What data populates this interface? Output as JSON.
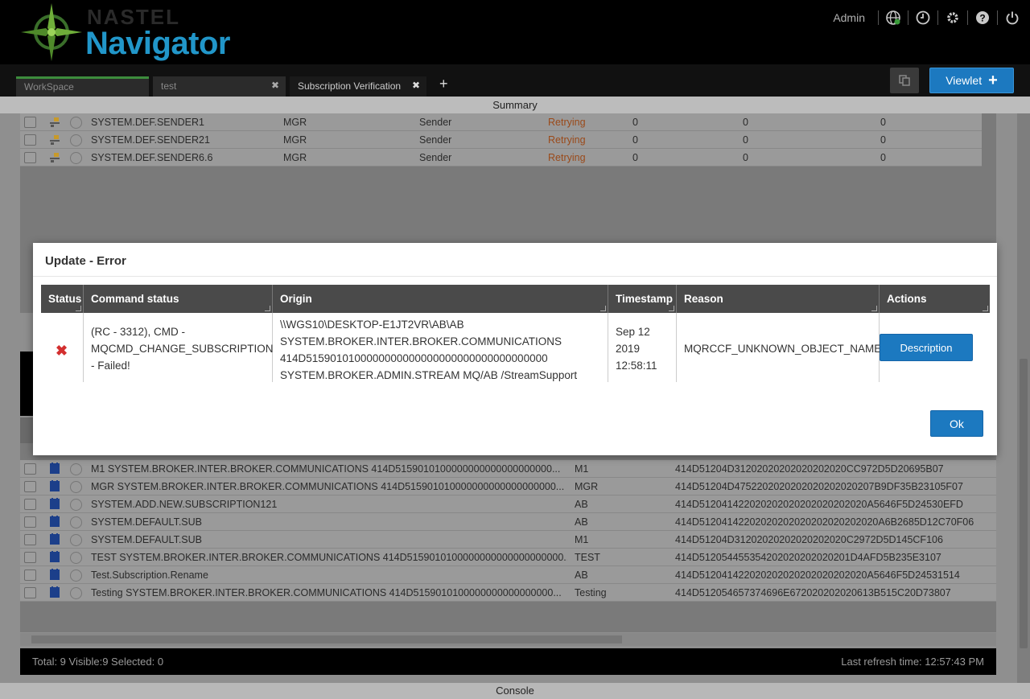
{
  "header": {
    "logo_top": "NASTEL",
    "logo_main": "Navigator",
    "user": "Admin"
  },
  "tabs": [
    {
      "label": "WorkSpace"
    },
    {
      "label": "test"
    },
    {
      "label": "Subscription Verification"
    }
  ],
  "toolbar": {
    "add_tab_label": "+",
    "viewlet_label": "Viewlet"
  },
  "summary_label": "Summary",
  "top_grid": {
    "rows": [
      {
        "name": "SYSTEM.DEF.SENDER1",
        "qmgr": "MGR",
        "type": "Sender",
        "status": "Retrying",
        "c1": "0",
        "c2": "0",
        "c3": "0"
      },
      {
        "name": "SYSTEM.DEF.SENDER21",
        "qmgr": "MGR",
        "type": "Sender",
        "status": "Retrying",
        "c1": "0",
        "c2": "0",
        "c3": "0"
      },
      {
        "name": "SYSTEM.DEF.SENDER6.6",
        "qmgr": "MGR",
        "type": "Sender",
        "status": "Retrying",
        "c1": "0",
        "c2": "0",
        "c3": "0"
      }
    ]
  },
  "bottom_grid": {
    "rows": [
      {
        "name": "M1 SYSTEM.BROKER.INTER.BROKER.COMMUNICATIONS 414D5159010100000000000000000000...",
        "qmgr": "M1",
        "id": "414D51204D31202020202020202020CC972D5D20695B07"
      },
      {
        "name": "MGR SYSTEM.BROKER.INTER.BROKER.COMMUNICATIONS 414D515901010000000000000000000...",
        "qmgr": "MGR",
        "id": "414D51204D4752202020202020202020207B9DF35B23105F07"
      },
      {
        "name": "SYSTEM.ADD.NEW.SUBSCRIPTION121",
        "qmgr": "AB",
        "id": "414D512041422020202020202020202020A5646F5D24530EFD"
      },
      {
        "name": "SYSTEM.DEFAULT.SUB",
        "qmgr": "AB",
        "id": "414D51204142202020202020202020202020A6B2685D12C70F06"
      },
      {
        "name": "SYSTEM.DEFAULT.SUB",
        "qmgr": "M1",
        "id": "414D51204D31202020202020202020C2972D5D145CF106"
      },
      {
        "name": "TEST SYSTEM.BROKER.INTER.BROKER.COMMUNICATIONS 414D5159010100000000000000000000...",
        "qmgr": "TEST",
        "id": "414D512054455354202020202020201D4AFD5B235E3107"
      },
      {
        "name": "Test.Subscription.Rename",
        "qmgr": "AB",
        "id": "414D512041422020202020202020202020A5646F5D24531514"
      },
      {
        "name": "Testing SYSTEM.BROKER.INTER.BROKER.COMMUNICATIONS 414D5159010100000000000000000...",
        "qmgr": "Testing",
        "id": "414D512054657374696E672020202020613B515C20D73807"
      }
    ]
  },
  "footer": {
    "totals": "Total: 9 Visible:9 Selected: 0",
    "refresh": "Last refresh time: 12:57:43 PM"
  },
  "console_label": "Console",
  "modal": {
    "title": "Update - Error",
    "columns": [
      "Status",
      "Command status",
      "Origin",
      "Timestamp",
      "Reason",
      "Actions"
    ],
    "row": {
      "command_status": "(RC - 3312), CMD - MQCMD_CHANGE_SUBSCRIPTION - Failed!",
      "origin_lines": [
        "\\\\WGS10\\DESKTOP-E1JT2VR\\AB\\AB",
        "SYSTEM.BROKER.INTER.BROKER.COMMUNICATIONS",
        "414D5159010100000000000000000000000000000000",
        "SYSTEM.BROKER.ADMIN.STREAM MQ/AB /StreamSupport"
      ],
      "timestamp_lines": [
        "Sep 12",
        "2019",
        "12:58:11"
      ],
      "reason": "MQRCCF_UNKNOWN_OBJECT_NAME",
      "action_label": "Description"
    },
    "ok_label": "Ok"
  }
}
